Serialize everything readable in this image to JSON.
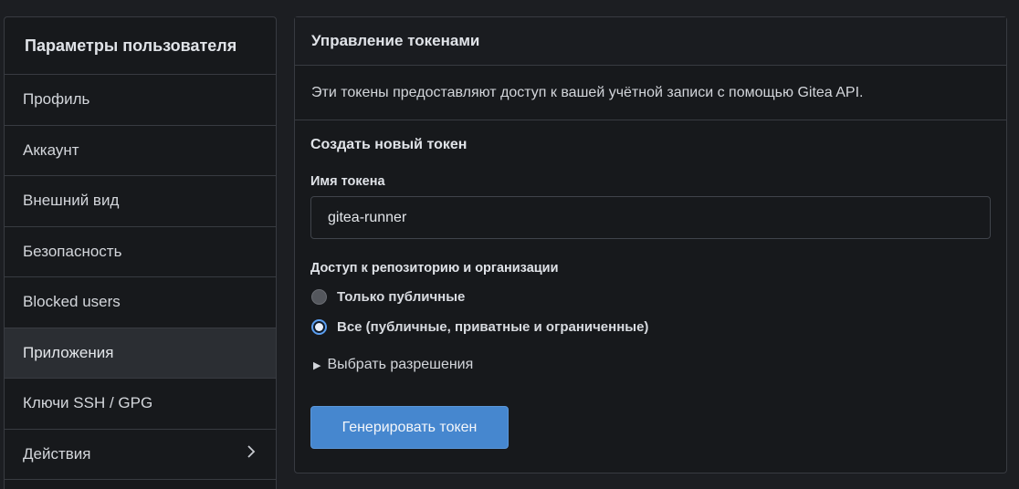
{
  "sidebar": {
    "title": "Параметры пользователя",
    "items": [
      {
        "label": "Профиль"
      },
      {
        "label": "Аккаунт"
      },
      {
        "label": "Внешний вид"
      },
      {
        "label": "Безопасность"
      },
      {
        "label": "Blocked users"
      },
      {
        "label": "Приложения",
        "active": true
      },
      {
        "label": "Ключи SSH / GPG"
      },
      {
        "label": "Действия",
        "icon": "chevron-right-icon"
      }
    ]
  },
  "panel": {
    "title": "Управление токенами",
    "description": "Эти токены предоставляют доступ к вашей учётной записи с помощью Gitea API.",
    "section_title": "Создать новый токен",
    "token_name_label": "Имя токена",
    "token_name_value": "gitea-runner",
    "access_label": "Доступ к репозиторию и организации",
    "access_options": [
      {
        "label": "Только публичные",
        "checked": false
      },
      {
        "label": "Все (публичные, приватные и ограниченные)",
        "checked": true
      }
    ],
    "permissions_toggle": "Выбрать разрешения",
    "generate_button": "Генерировать токен"
  },
  "colors": {
    "accent": "#4687cf",
    "background": "#1c1e22",
    "panel": "#17191c"
  }
}
